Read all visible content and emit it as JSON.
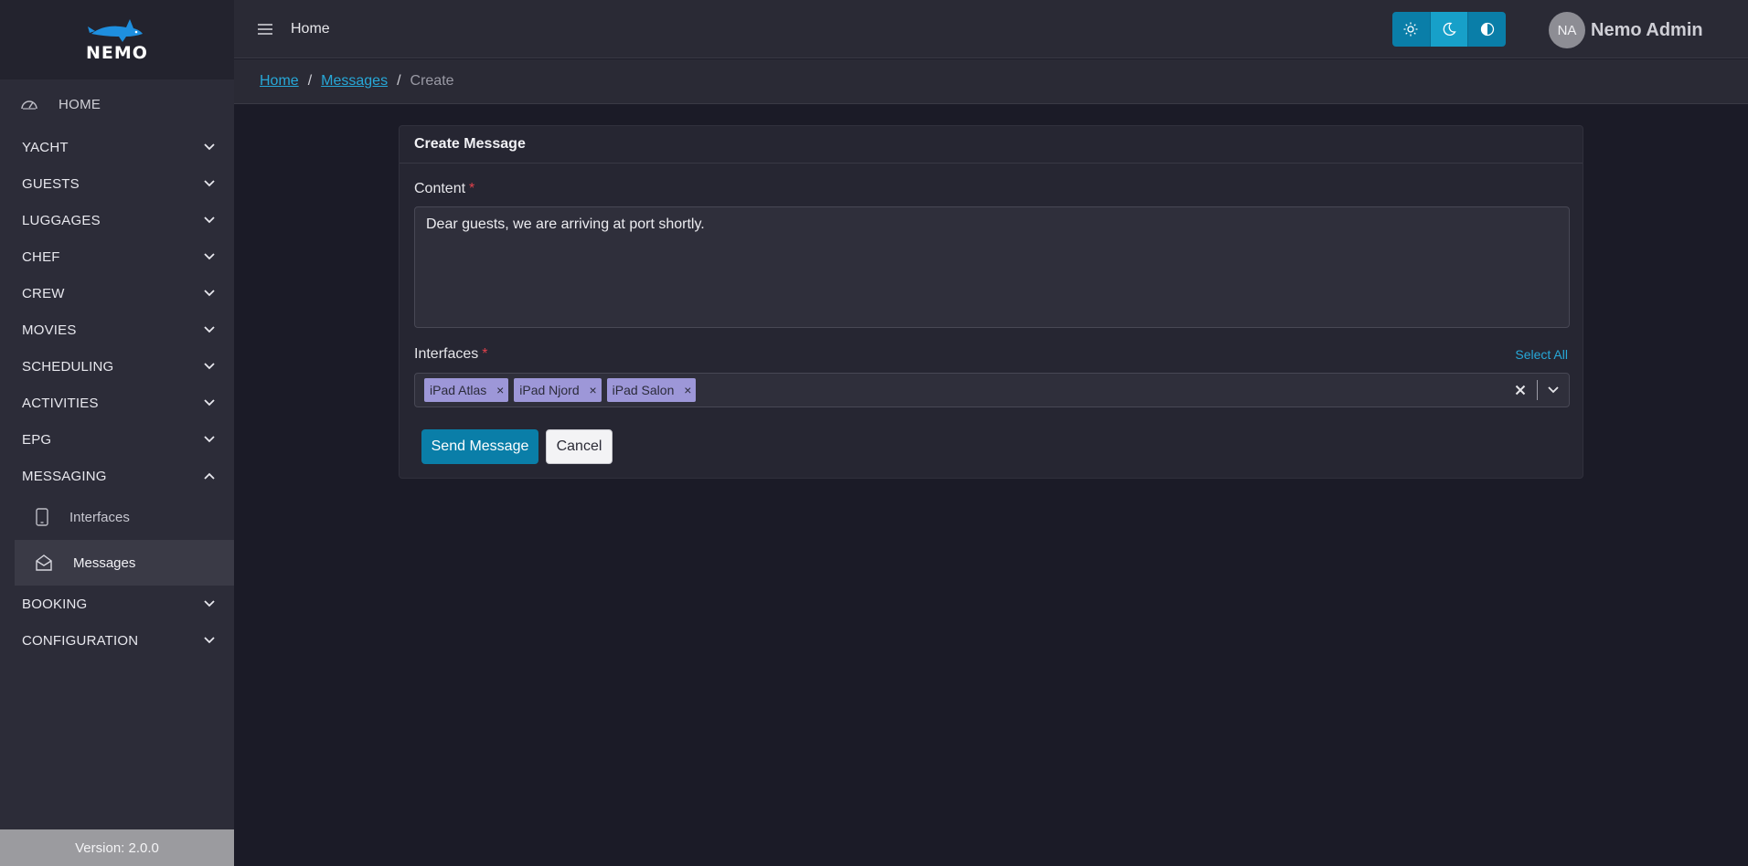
{
  "app": {
    "logo_text": "NEMO",
    "version": "Version: 2.0.0"
  },
  "sidebar": {
    "home": "HOME",
    "items": [
      {
        "label": "YACHT",
        "expanded": false
      },
      {
        "label": "GUESTS",
        "expanded": false
      },
      {
        "label": "LUGGAGES",
        "expanded": false
      },
      {
        "label": "CHEF",
        "expanded": false
      },
      {
        "label": "CREW",
        "expanded": false
      },
      {
        "label": "MOVIES",
        "expanded": false
      },
      {
        "label": "SCHEDULING",
        "expanded": false
      },
      {
        "label": "ACTIVITIES",
        "expanded": false
      },
      {
        "label": "EPG",
        "expanded": false
      },
      {
        "label": "MESSAGING",
        "expanded": true
      },
      {
        "label": "BOOKING",
        "expanded": false
      },
      {
        "label": "CONFIGURATION",
        "expanded": false
      }
    ],
    "messaging_sub": [
      {
        "label": "Interfaces",
        "icon": "tablet-icon",
        "active": false
      },
      {
        "label": "Messages",
        "icon": "envelope-open-icon",
        "active": true
      }
    ]
  },
  "header": {
    "title": "Home",
    "theme_options": [
      "light-theme-icon",
      "dark-theme-icon",
      "auto-theme-icon"
    ],
    "active_theme": "dark",
    "user": {
      "initials": "NA",
      "name": "Nemo Admin"
    }
  },
  "breadcrumb": {
    "items": [
      "Home",
      "Messages"
    ],
    "current": "Create"
  },
  "form": {
    "title": "Create Message",
    "content_label": "Content",
    "content_value": "Dear guests, we are arriving at port shortly.",
    "required_mark": "*",
    "interfaces_label": "Interfaces",
    "select_all": "Select All",
    "selected_interfaces": [
      "iPad Atlas",
      "iPad Njord",
      "iPad Salon"
    ],
    "tag_remove": "×",
    "send_label": "Send Message",
    "cancel_label": "Cancel"
  },
  "colors": {
    "accent": "#0a7ea8",
    "link": "#27a8d8",
    "tag": "#9d97d8",
    "required": "#e0414b"
  }
}
